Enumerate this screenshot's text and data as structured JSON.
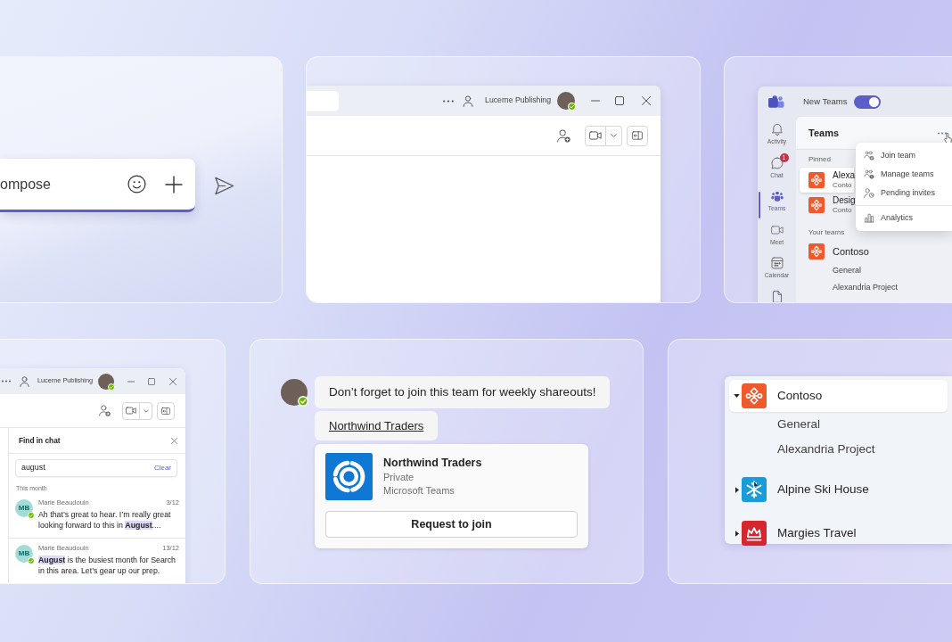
{
  "compose_panel": {
    "compose_box": {
      "placeholder": "ompose"
    }
  },
  "channel_window": {
    "title_bar": {
      "account_name": "Lucerne Publishing"
    }
  },
  "teams_window": {
    "title_bar": {
      "label": "New Teams",
      "toggle": {
        "on": true
      }
    },
    "rail": [
      {
        "label": "Activity",
        "selected": false
      },
      {
        "label": "Chat",
        "badge": "1",
        "selected": false
      },
      {
        "label": "Teams",
        "selected": true
      },
      {
        "label": "Meet",
        "selected": false
      },
      {
        "label": "Calendar",
        "selected": false
      },
      {
        "selected": false
      }
    ],
    "teams_list": {
      "title": "Teams",
      "sections": [
        {
          "heading": "Pinned",
          "teams": [
            {
              "name": "Alexa",
              "subtitle": "Conto",
              "selected": true
            },
            {
              "name": "Desig",
              "subtitle": "Conto",
              "selected": false
            }
          ]
        },
        {
          "heading": "Your teams",
          "teams": [
            {
              "name": "Contoso",
              "selected": false,
              "children": [
                {
                  "name": "General"
                },
                {
                  "name": "Alexandria Project"
                }
              ]
            }
          ]
        }
      ]
    },
    "menu": [
      {
        "items": [
          "Join team",
          "Manage teams",
          "Pending invites"
        ]
      },
      {
        "items": [
          "Analytics"
        ]
      }
    ]
  },
  "find_window": {
    "title_bar": {
      "account_name": "Lucerne Publishing"
    },
    "find_panel": {
      "title": "Find in chat",
      "search": {
        "value": "august",
        "action": "Clear"
      },
      "group_label": "This month",
      "results": [
        {
          "initials": "MB",
          "author": "Marie Beaudouin",
          "date": "3/12",
          "text": "Ah that’s great to hear. I’m really great looking forward to this in **August**...."
        },
        {
          "initials": "MB",
          "author": "Marie Beaudouin",
          "date": "13/12",
          "text": "**August** is the busiest month for Search in this area. Let’s gear up our prep."
        }
      ]
    }
  },
  "message_panel": {
    "messages": [
      {
        "kind": "text",
        "text": "Don’t forget to join this team for weekly shareouts!"
      },
      {
        "kind": "link",
        "text": "Northwind Traders"
      }
    ],
    "card": {
      "title": "Northwind Traders",
      "privacy": "Private",
      "source": "Microsoft Teams",
      "button": "Request to join"
    }
  },
  "tree_panel": {
    "teams": [
      {
        "name": "Contoso",
        "color": "#f0592b",
        "expanded": true,
        "selected": true,
        "children": [
          {
            "name": "General"
          },
          {
            "name": "Alexandria Project"
          }
        ]
      },
      {
        "name": "Alpine Ski House",
        "color": "#1a9cd8",
        "expanded": false,
        "selected": false
      },
      {
        "name": "Margies Travel",
        "color": "#d3262f",
        "expanded": false,
        "selected": false
      }
    ]
  }
}
